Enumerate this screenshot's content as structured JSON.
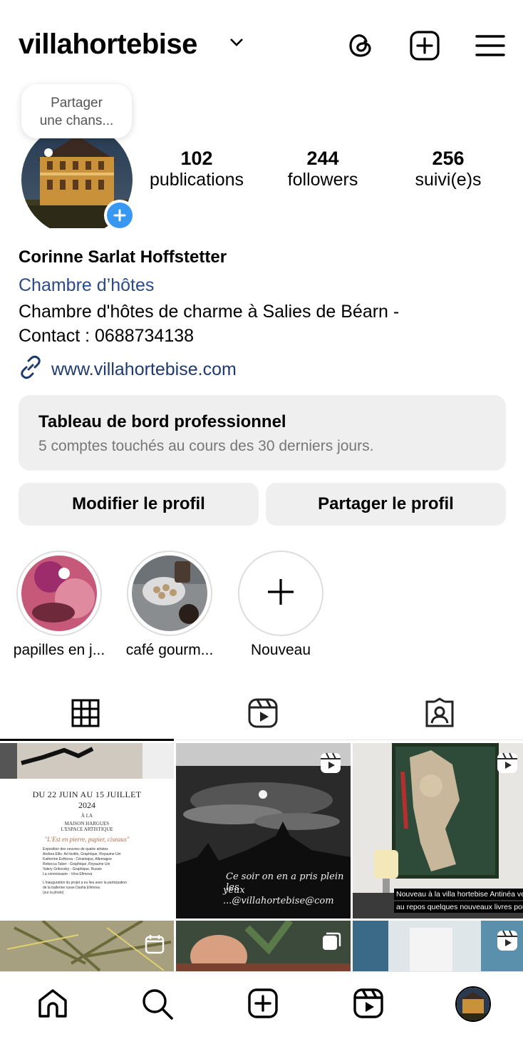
{
  "header": {
    "username": "villahortebise",
    "icons": [
      "threads-icon",
      "create-icon",
      "menu-icon"
    ]
  },
  "note_bubble": {
    "line1": "Partager",
    "line2": "une chans..."
  },
  "stats": [
    {
      "value": "102",
      "label": "publications"
    },
    {
      "value": "244",
      "label": "followers"
    },
    {
      "value": "256",
      "label": "suivi(e)s"
    }
  ],
  "profile": {
    "name": "Corinne Sarlat Hoffstetter",
    "category": "Chambre d’hôtes",
    "bio_line1": "Chambre d'hôtes de charme à Salies de Béarn -",
    "bio_line2": "Contact : 0688734138",
    "website": "www.villahortebise.com"
  },
  "dashboard": {
    "title": "Tableau de bord professionnel",
    "subtitle": "5 comptes touchés au cours des 30 derniers jours."
  },
  "buttons": {
    "edit": "Modifier le profil",
    "share": "Partager le profil"
  },
  "highlights": [
    {
      "label": "papilles en j..."
    },
    {
      "label": "café gourm..."
    },
    {
      "label": "Nouveau"
    }
  ],
  "posts": {
    "poster": {
      "dates": "DU 22 JUIN AU 15 JUILLET",
      "year": "2024",
      "a_la": "À LA",
      "venue1": "MAISON HARGUES",
      "venue2": "L'ESPACE ARTISTIQUE",
      "quote": "\"L'Est en pierre, papier, ciseaux\"",
      "line1": "Exposition des oeuvres de quatre artistes",
      "line2": "Andrea Ellis- Art textile, Graphique, Royaume Uni",
      "line3": "Katherine Eshkova - Céramique, Allemagne",
      "line4": "Rebecca Taber - Graphique, Royaume Uni",
      "line5": "Valery Grikovsky - Graphique, Russie",
      "line6": "La commissaire - Véra Efimova",
      "line7": "L'inauguration du projet a eu lieu avec la participation",
      "line8": "de la ballerine russe Dasha Efimova",
      "line9": "(sur la photo)"
    },
    "moon_caption1": "Ce soir on en a pris plein les",
    "moon_caption2": "yeux ...@villahortebise@com",
    "art_caption1": "Nouveau à la villa hortebise Antinéa veil",
    "art_caption2": "au repos quelques nouveaux livres pour"
  },
  "bottom_nav": [
    "home-icon",
    "search-icon",
    "create-icon",
    "reels-icon",
    "profile-avatar"
  ],
  "colors": {
    "link": "#1e3a70",
    "badge": "#3897f0",
    "button_bg": "#efefef"
  }
}
